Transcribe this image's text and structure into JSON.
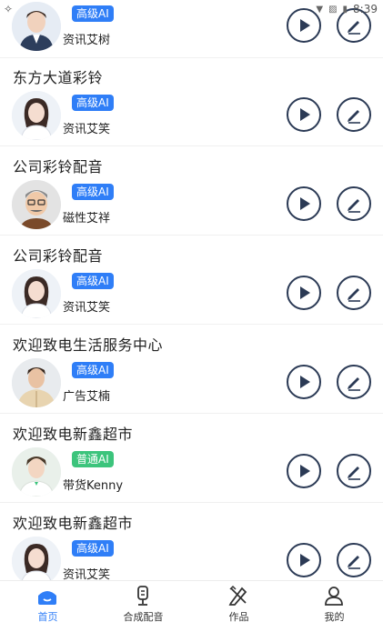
{
  "status": {
    "time": "8:39"
  },
  "sections": [
    {
      "title": "",
      "voice": {
        "badge": "高级AI",
        "badge_type": "adv",
        "name": "资讯艾树",
        "avatar": "male-suit"
      }
    },
    {
      "title": "东方大道彩铃",
      "voice": {
        "badge": "高级AI",
        "badge_type": "adv",
        "name": "资讯艾笑",
        "avatar": "female-white"
      }
    },
    {
      "title": "公司彩铃配音",
      "voice": {
        "badge": "高级AI",
        "badge_type": "adv",
        "name": "磁性艾祥",
        "avatar": "male-glasses"
      }
    },
    {
      "title": "公司彩铃配音",
      "voice": {
        "badge": "高级AI",
        "badge_type": "adv",
        "name": "资讯艾笑",
        "avatar": "female-white"
      }
    },
    {
      "title": "欢迎致电生活服务中心",
      "voice": {
        "badge": "高级AI",
        "badge_type": "adv",
        "name": "广告艾楠",
        "avatar": "male-beige"
      }
    },
    {
      "title": "欢迎致电新鑫超市",
      "voice": {
        "badge": "普通AI",
        "badge_type": "std",
        "name": "带货Kenny",
        "avatar": "male-light"
      }
    },
    {
      "title": "欢迎致电新鑫超市",
      "voice": {
        "badge": "高级AI",
        "badge_type": "adv",
        "name": "资讯艾笑",
        "avatar": "female-white"
      }
    }
  ],
  "tabbar": {
    "tabs": [
      {
        "label": "首页",
        "icon": "home-icon",
        "active": true
      },
      {
        "label": "合成配音",
        "icon": "microphone-icon",
        "active": false
      },
      {
        "label": "作品",
        "icon": "works-icon",
        "active": false
      },
      {
        "label": "我的",
        "icon": "profile-icon",
        "active": false
      }
    ]
  },
  "colors": {
    "accent": "#2f7ef7",
    "badge_standard": "#3cc47c",
    "button_outline": "#2b3a55"
  }
}
